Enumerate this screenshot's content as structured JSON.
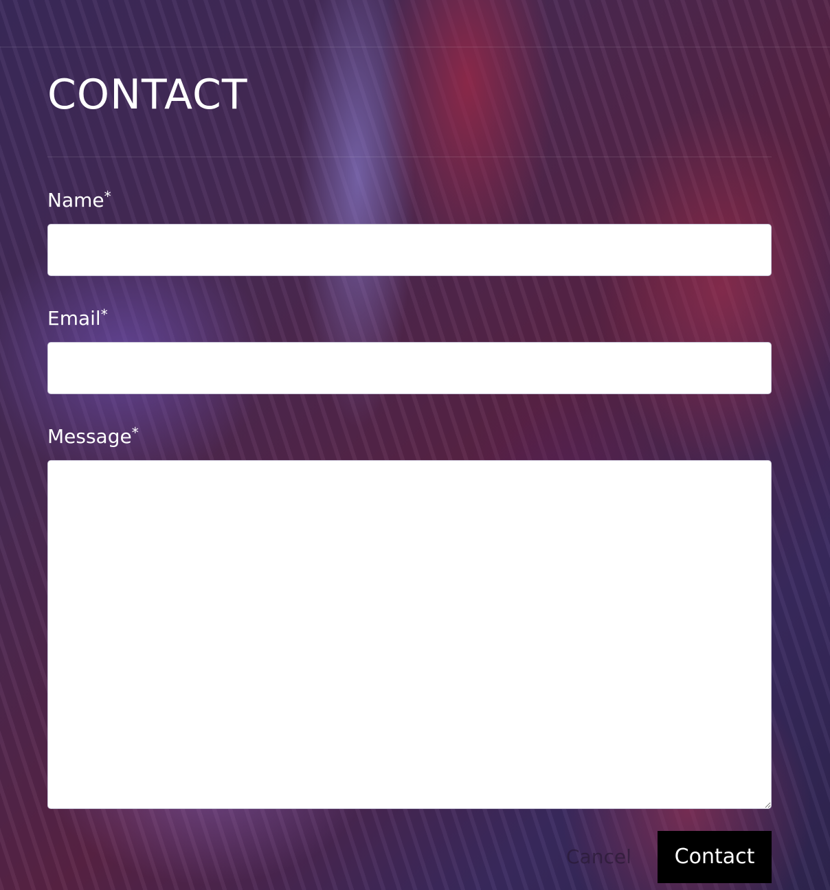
{
  "page": {
    "title": "CONTACT"
  },
  "form": {
    "name_label": "Name",
    "email_label": "Email",
    "message_label": "Message",
    "required_marker": "*",
    "name_value": "",
    "email_value": "",
    "message_value": ""
  },
  "actions": {
    "cancel_label": "Cancel",
    "submit_label": "Contact"
  },
  "colors": {
    "submit_background": "#000000",
    "text": "#ffffff",
    "field_background": "#ffffff"
  }
}
